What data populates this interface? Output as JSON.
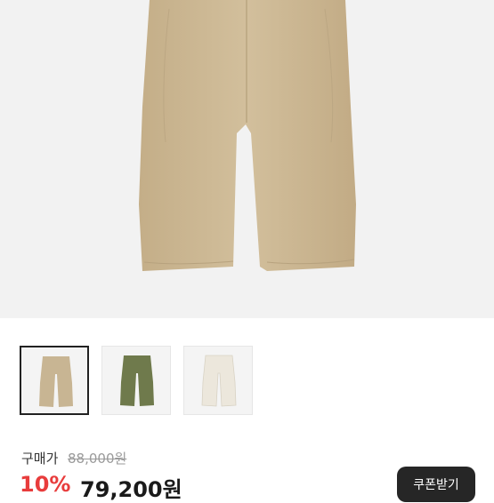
{
  "product": {
    "hero_image": "beige-pants-image",
    "thumbnails": [
      {
        "name": "beige-pants-thumbnail",
        "color": "#c8b593",
        "selected": true
      },
      {
        "name": "olive-pants-thumbnail",
        "color": "#6f7a4c",
        "selected": false
      },
      {
        "name": "ivory-pants-thumbnail",
        "color": "#ece7dc",
        "selected": false
      }
    ]
  },
  "pricing": {
    "original_label": "구매가",
    "original_price": "88,000원",
    "discount_rate": "10%",
    "sale_price": "79,200원"
  },
  "actions": {
    "coupon_label": "쿠폰받기"
  },
  "colors": {
    "discount": "#e83c3c",
    "button_bg": "#262626"
  }
}
